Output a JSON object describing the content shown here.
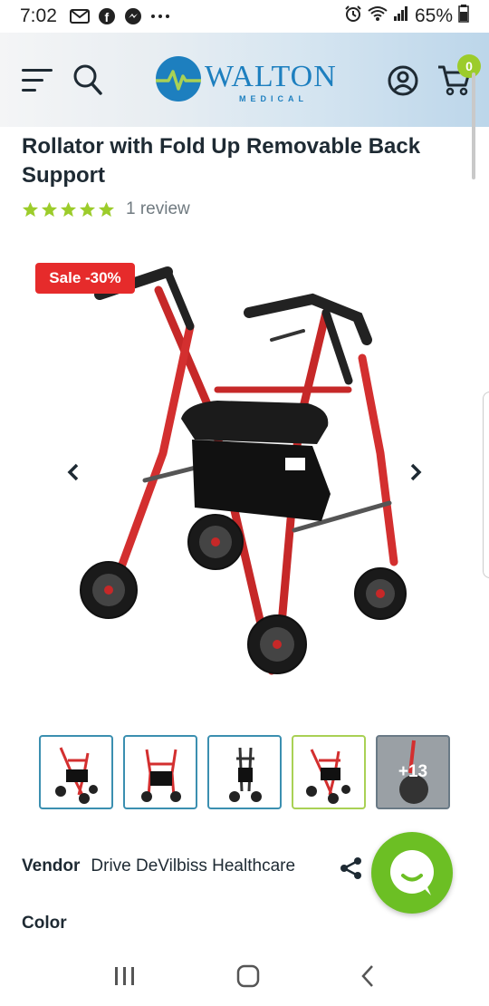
{
  "status_bar": {
    "time": "7:02",
    "battery": "65%"
  },
  "header": {
    "logo_main": "WALTON",
    "logo_sub": "MEDICAL",
    "cart_count": "0"
  },
  "product": {
    "title": "Rollator with Fold Up Removable Back Support",
    "rating": 5,
    "review_count": "1 review",
    "sale_badge": "Sale -30%",
    "more_images": "+13",
    "vendor_label": "Vendor",
    "vendor_name": "Drive DeVilbiss Healthcare",
    "color_label": "Color"
  },
  "colors": {
    "accent": "#9ccc2b",
    "brand": "#1d7fbf",
    "sale": "#e62b2b",
    "chat": "#6cbf24",
    "frame": "#d32f2f"
  }
}
